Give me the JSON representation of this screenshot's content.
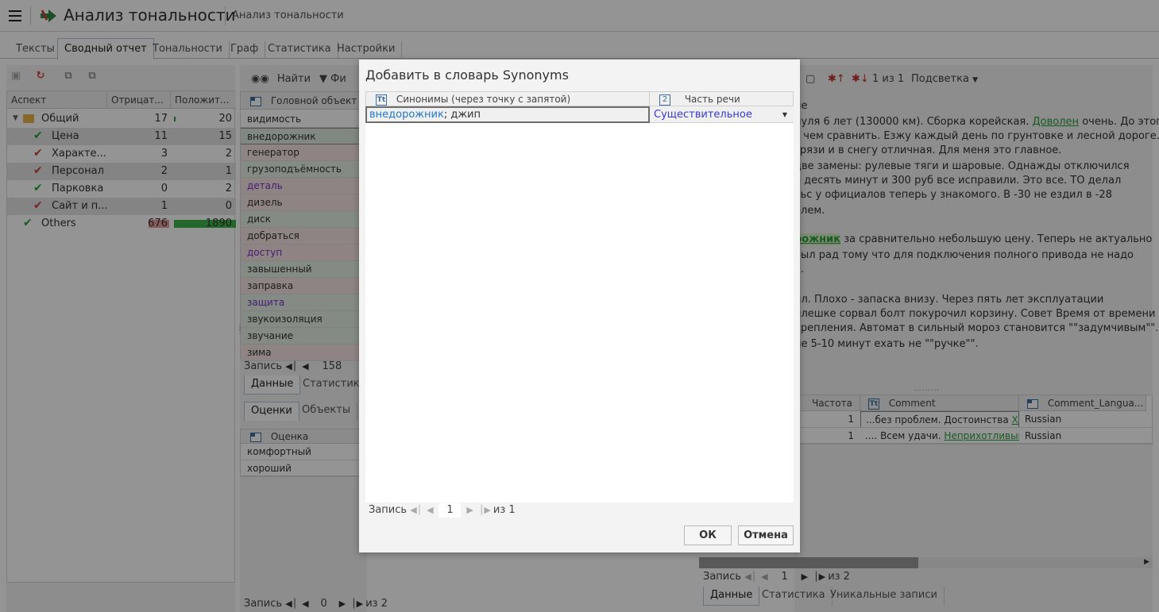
{
  "header": {
    "title": "Анализ тональности",
    "subtitle": "Анализ тональности"
  },
  "tabs": [
    "Тексты",
    "Сводный отчет",
    "Тональности",
    "Граф",
    "Статистика",
    "Настройки"
  ],
  "left_grid": {
    "headers": [
      "Аспект",
      "Отрицат...",
      "Положит..."
    ],
    "rows": [
      {
        "label": "Общий",
        "neg": "17",
        "pos": "20"
      },
      {
        "label": "Цена",
        "neg": "11",
        "pos": "15"
      },
      {
        "label": "Характе...",
        "neg": "3",
        "pos": "2"
      },
      {
        "label": "Персонал",
        "neg": "2",
        "pos": "1"
      },
      {
        "label": "Парковка",
        "neg": "0",
        "pos": "2"
      },
      {
        "label": "Сайт и п...",
        "neg": "1",
        "pos": "0"
      },
      {
        "label": "Others",
        "neg": "676",
        "pos": "1890"
      }
    ],
    "nav": {
      "label": "Запись",
      "current": "0",
      "of": "из 2"
    }
  },
  "mid": {
    "toolbar": {
      "find": "Найти",
      "filter": "Фи"
    },
    "header": "Головной объект",
    "rows": [
      "видимость",
      "внедорожник",
      "генератор",
      "грузоподъёмность",
      "деталь",
      "дизель",
      "диск",
      "добраться",
      "доступ",
      "завышенный",
      "заправка",
      "защита",
      "звукоизоляция",
      "звучание",
      "зима"
    ],
    "nav": {
      "label": "Запись",
      "current": "158"
    },
    "tabs": [
      "Данные",
      "Статистика"
    ],
    "tabs2": [
      "Оценки",
      "Объекты"
    ],
    "grid2_header": "Оценка",
    "grid2_rows": [
      "комфортный",
      "хороший"
    ]
  },
  "right": {
    "toolbar": {
      "count": "1 из 1",
      "highlight": "Подсветка"
    },
    "text_lines": [
      "ие",
      "нуля 6 лет (130000 км). Сборка корейская. ",
      "с чем сравнить. Езжу каждый день по грунтовке и лесной дороге.",
      " грязи и в снегу отличная. Для меня это главное.",
      "две замены: рулевые тяги и шаровые. Однажды отключился",
      "о десять минут и 300 руб все исправили. Это все. ТО делал",
      "тьс у официалов теперь у знакомого. В -30 не ездил в -28",
      "блем.",
      "",
      " за сравнительно небольшую цену. Теперь не актуально",
      "был рад тому что для подключения полного привода не надо",
      "у.",
      "",
      "ил. Плохо - запаска внизу. Через пять лет эксплуатации",
      "плешке сорвал болт покурочил корзину. Совет Время от времени",
      "крепления. Автомат в сильный мороз становится \"\"задумчивым\"\".",
      "не 5-10 минут ехать не \"\"ручке\"\"."
    ],
    "link_doволен": "Доволен",
    "after_link": " очень. До этого",
    "highlight_word": "рожник",
    "suffix": " очень. До этого",
    "grid_headers": [
      "Частота",
      "Comment",
      "Comment_Langua..."
    ],
    "grid_rows": [
      {
        "freq": "1",
        "comment": "...без проблем. Достоинства ",
        "comment_link": "Хор",
        "lang": "Russian"
      },
      {
        "freq": "1",
        "comment": ".... Всем удачи. ",
        "comment_link": "Неприхотливый к",
        "lang": "Russian"
      }
    ],
    "nav": {
      "label": "Запись",
      "current": "1",
      "of": "из 2"
    },
    "tabs": [
      "Данные",
      "Статистика",
      "Уникальные записи"
    ]
  },
  "dialog": {
    "title": "Добавить в словарь Synonyms",
    "col1": "Синонимы (через точку с запятой)",
    "col2": "Часть речи",
    "row_link": "внедорожник",
    "row_rest": "; джип",
    "row_pos": "Существительное",
    "nav": {
      "label": "Запись",
      "current": "1",
      "of": "из 1"
    },
    "ok": "ОК",
    "cancel": "Отмена"
  },
  "colors": {
    "accent": "#3a6ea5",
    "positive": "#2a9d3a",
    "negative": "#c94040",
    "link": "#2277cc"
  }
}
